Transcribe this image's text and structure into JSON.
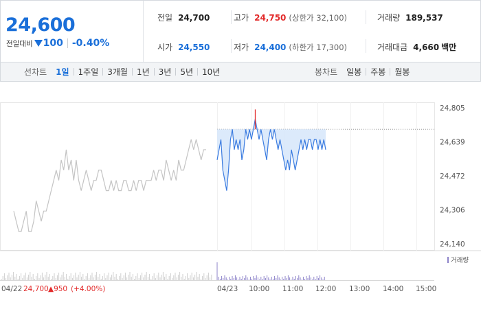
{
  "summary": {
    "price": "24,600",
    "change_label": "전일대비",
    "change_amount": "100",
    "change_percent": "-0.40%",
    "prev_close_label": "전일",
    "prev_close": "24,700",
    "high_label": "고가",
    "high": "24,750",
    "upper_limit": "(상한가 32,100)",
    "volume_label": "거래량",
    "volume": "189,537",
    "open_label": "시가",
    "open": "24,550",
    "low_label": "저가",
    "low": "24,400",
    "lower_limit": "(하한가 17,300)",
    "amount_label": "거래대금",
    "amount": "4,660",
    "amount_unit": "백만"
  },
  "tabs": {
    "line_title": "선차트",
    "line_tabs": [
      "1일",
      "1주일",
      "3개월",
      "1년",
      "3년",
      "5년",
      "10년"
    ],
    "line_active": "1일",
    "candle_title": "봉차트",
    "candle_tabs": [
      "일봉",
      "주봉",
      "월봉"
    ]
  },
  "colors": {
    "up": "#e22a2a",
    "down": "#1a6fd9",
    "today_line": "#3a7be0",
    "today_fill": "#d6e6fa",
    "prev_line": "#c4c4c4",
    "volume_today": "#8d83c9",
    "volume_prev": "#cfcfcf"
  },
  "chart_data": {
    "type": "line",
    "y_ticks": [
      "24,805",
      "24,639",
      "24,472",
      "24,306",
      "24,140"
    ],
    "ylim": [
      24140,
      24805
    ],
    "x_ticks": [
      "04/22",
      "04/23",
      "10:00",
      "11:00",
      "12:00",
      "13:00",
      "14:00",
      "15:00"
    ],
    "legend_volume": "거래량",
    "footer": {
      "date": "04/22",
      "close": "24,700",
      "change": "▲950",
      "percent": "(+4.00%)"
    },
    "prev_close_reference": 24700,
    "series": [
      {
        "values": [
          24300,
          24250,
          24200,
          24200,
          24250,
          24300,
          24200,
          24200,
          24250,
          24350,
          24300,
          24250,
          24300,
          24300,
          24350,
          24400,
          24450,
          24500,
          24450,
          24550,
          24500,
          24600,
          24500,
          24550,
          24450,
          24550,
          24450,
          24400,
          24450,
          24500,
          24450,
          24400,
          24450,
          24450,
          24500,
          24500,
          24450,
          24400,
          24400,
          24450,
          24400,
          24450,
          24400,
          24400,
          24450,
          24450,
          24400,
          24400,
          24450,
          24400,
          24450,
          24450,
          24400,
          24450,
          24450,
          24450,
          24500,
          24450,
          24500,
          24500,
          24450,
          24550,
          24500,
          24450,
          24500,
          24450,
          24550,
          24500,
          24500,
          24550,
          24600,
          24650,
          24600,
          24650,
          24600,
          24550,
          24600,
          24600
        ]
      },
      {
        "values": [
          24550,
          24600,
          24650,
          24500,
          24450,
          24400,
          24500,
          24650,
          24700,
          24600,
          24650,
          24600,
          24650,
          24550,
          24600,
          24700,
          24650,
          24700,
          24650,
          24700,
          24750,
          24700,
          24650,
          24700,
          24650,
          24600,
          24550,
          24650,
          24700,
          24650,
          24700,
          24650,
          24600,
          24650,
          24600,
          24550,
          24500,
          24550,
          24500,
          24600,
          24550,
          24500,
          24550,
          24600,
          24650,
          24600,
          24650,
          24600,
          24650,
          24650,
          24600,
          24650,
          24650,
          24600,
          24650,
          24600,
          24650,
          24600
        ]
      }
    ]
  }
}
